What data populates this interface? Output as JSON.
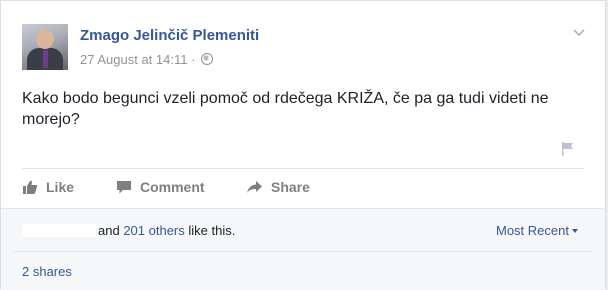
{
  "post": {
    "author": "Zmago Jelinčič Plemeniti",
    "timestamp": "27 August at 14:11",
    "separator": "·",
    "privacy_icon": "globe-icon",
    "text": "Kako bodo begunci vzeli pomoč od rdečega KRIŽA, če pa ga tudi videti ne morejo?"
  },
  "actions": {
    "like_label": "Like",
    "comment_label": "Comment",
    "share_label": "Share"
  },
  "reactions": {
    "and_text": "and",
    "others_link": "201 others",
    "like_this": "like this."
  },
  "sort": {
    "label": "Most Recent"
  },
  "shares": {
    "label": "2 shares"
  },
  "colors": {
    "link": "#365899",
    "muted": "#90949c",
    "action": "#7f7f7f"
  }
}
